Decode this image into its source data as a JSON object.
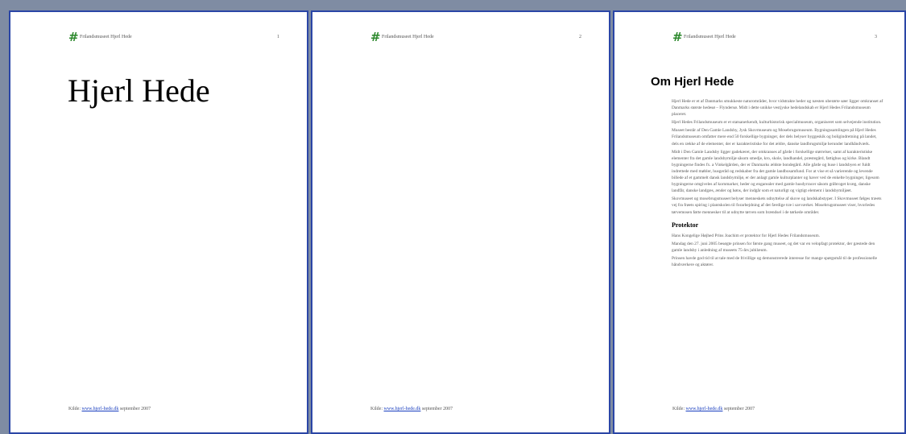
{
  "header": {
    "icon": "hash-icon",
    "title": "Frilandsmuseet Hjerl Hede"
  },
  "footer": {
    "prefix": "Kilde:",
    "link": "www.hjerl-hede.dk",
    "suffix": "september 2007"
  },
  "pages": [
    {
      "number": "1",
      "title": "Hjerl Hede"
    },
    {
      "number": "2"
    },
    {
      "number": "3",
      "heading": "Om Hjerl Hede",
      "paragraphs": [
        "Hjerl Hede er et af Danmarks smukkeste naturområder, hvor vidstrakte heder og næsten uberørte søer ligger omkranset af Danmarks største hedesø – Flyndersø. Midt i dette unikke vestjyske hedelandskab er Hjerl Hedes Frilandsmuseum placeret.",
        "Hjerl Hedes Frilandsmuseum er et statsanerkendt, kulturhistorisk specialmuseum, organiseret som selvejende institution.",
        "Museet består af Den Gamle Landsby, Jysk Skovmuseum og Mosebrugsmuseum. Bygningssamlingen på Hjerl Hedes Frilandsmuseum omfatter mere end 50 forskellige bygninger, der dels belyser byggeskik og bolig­indretning på landet, dels en række af de elementer, der er karakteristiske for det ældre, danske landbrugsmiljø herunder landhåndværk.",
        "Midt i Den Gamle Landsby ligger gadekæret, der omkranses af gårde i forskellige størrelser, samt af karakteristiske elementer fra det gamle landsbymiljø såsom smedje, kro, skole, landhandel, præstegård, fattighus og kirke. Blandt bygningerne findes fx. a Vinkelgården, der er Danmarks ældste bondegård. Alle gårde og huse i landsbyen er fuldt indrettede med møbler, husgeråd og redskaber fra det gamle landbosamfund. For at vise et så varierende og levende billede af et gammelt dansk landsbymiljø, er der anlagt gamle kulturplanter og haver ved de enkelte bygninger, ligesom bygningerne omgiveles af kornmarker, heder og engarealer med gamle husdyrracer såsom grå­broget kvæg, danske landfår, danske landgæs, ænder og høns, der indgår som et naturligt og vigtigt element i landsbymiljøet.",
        "Skovmuseet og mosebrugsmuseet belyser menneskets udnyttelse af skove og landskabstyper. I Skovmuseet følges træets vej fra frøets spiring i plantskolen til forarbejdning af det færdige træ i savværket. Mosebrugsmuseet viser, hvorledes tørvemosen førte mennesker til at udnytte tørven som brændsel i de tørkede områder."
      ],
      "subheading": "Protektor",
      "paragraphs2": [
        "Hans Kongelige Højhed Prins Joachim er protektor for Hjerl Hedes Frilandsmuseum.",
        "Mandag den 27. juni 2005 besøgte prinsen for første gang museet, og det var en velopfagt protektor, der gæstede den gamle landsby i anledning af museets 75-års jubilæum.",
        "Prinsen havde god tid til at tale med de frivillige og demonstrerede interesse for mange spørgsmål til de professionelle håndværkere og aktører."
      ]
    }
  ]
}
